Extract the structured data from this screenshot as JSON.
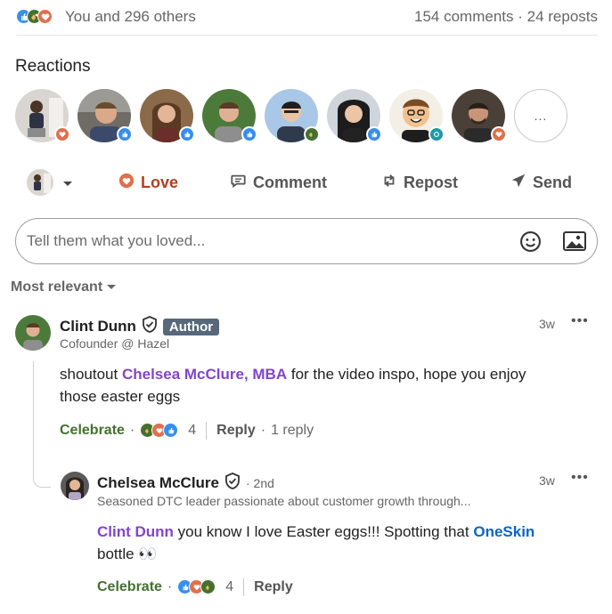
{
  "summary": {
    "reactors_text": "You and 296 others",
    "counts_text": "154 comments · 24 reposts"
  },
  "reactions": {
    "title": "Reactions",
    "more_label": "..."
  },
  "actions": {
    "love": "Love",
    "comment": "Comment",
    "repost": "Repost",
    "send": "Send"
  },
  "comment_box": {
    "placeholder": "Tell them what you loved..."
  },
  "sort": {
    "label": "Most relevant"
  },
  "comments": [
    {
      "name": "Clint Dunn",
      "badge": "Author",
      "headline": "Cofounder @ Hazel",
      "time": "3w",
      "text_pre": "shoutout ",
      "mention": "Chelsea McClure, MBA",
      "text_post_1": " for the video inspo, hope you enjoy",
      "text_line2": "those easter eggs",
      "reaction_label": "Celebrate",
      "reaction_count": "4",
      "reply_label": "Reply",
      "replies_text": "1 reply"
    },
    {
      "name": "Chelsea McClure",
      "degree": "· 2nd",
      "headline": "Seasoned DTC leader passionate about customer growth through...",
      "time": "3w",
      "mention": "Clint Dunn",
      "text_mid": " you know I love Easter eggs!!! Spotting that ",
      "mention2": "OneSkin",
      "text_line2": " bottle 👀",
      "reaction_label": "Celebrate",
      "reaction_count": "4",
      "reply_label": "Reply"
    }
  ],
  "colors": {
    "like": "#378fe9",
    "celebrate": "#44712e",
    "love": "#df704d",
    "mention_purple": "#8344cc",
    "mention_blue": "#0a66c2"
  }
}
